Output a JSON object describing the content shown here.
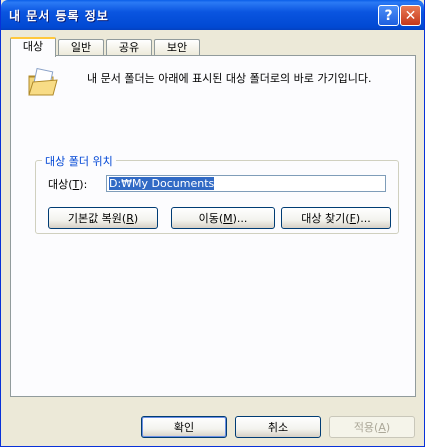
{
  "window": {
    "title": "내 문서 등록 정보",
    "help_label": "?",
    "close_label": "✕"
  },
  "tabs": [
    {
      "label": "대상"
    },
    {
      "label": "일반"
    },
    {
      "label": "공유"
    },
    {
      "label": "보안"
    }
  ],
  "description": "내 문서 폴더는 아래에 표시된 대상 폴더로의 바로 가기입니다.",
  "group": {
    "legend": "대상 폴더 위치",
    "target_label_pre": "대상(",
    "target_label_key": "T",
    "target_label_post": "):",
    "target_value": "D:₩My Documents"
  },
  "buttons": {
    "restore_pre": "기본값 복원(",
    "restore_key": "R",
    "restore_post": ")",
    "move_pre": "이동(",
    "move_key": "M",
    "move_post": ")...",
    "find_pre": "대상 찾기(",
    "find_key": "F",
    "find_post": ")...",
    "ok": "확인",
    "cancel": "취소",
    "apply_pre": "적용(",
    "apply_key": "A",
    "apply_post": ")"
  },
  "icons": {
    "folder": "my-documents-folder-icon"
  }
}
